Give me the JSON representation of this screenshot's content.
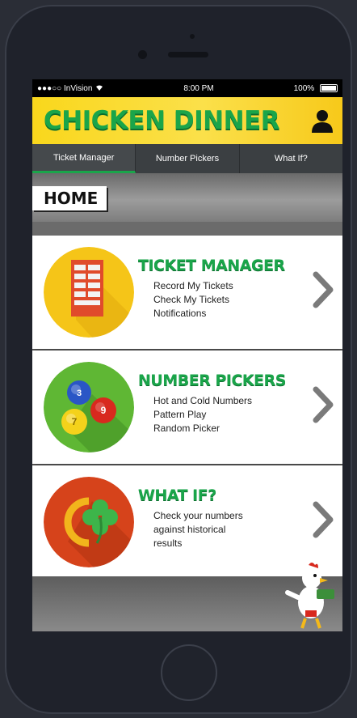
{
  "statusbar": {
    "carrier": "●●●○○ InVision",
    "time": "8:00 PM",
    "battery": "100%"
  },
  "header": {
    "title": "CHICKEN DINNER"
  },
  "tabs": [
    {
      "label": "Ticket Manager"
    },
    {
      "label": "Number Pickers"
    },
    {
      "label": "What If?"
    }
  ],
  "home": {
    "label": "HOME"
  },
  "cards": [
    {
      "title": "TICKET MANAGER",
      "lines": [
        "Record My Tickets",
        "Check My Tickets",
        "Notifications"
      ]
    },
    {
      "title": "NUMBER PICKERS",
      "lines": [
        "Hot and Cold Numbers",
        "Pattern Play",
        "Random Picker"
      ]
    },
    {
      "title": "WHAT IF?",
      "lines": [
        "Check your numbers",
        "against historical",
        "results"
      ]
    }
  ],
  "balls": [
    "3",
    "9",
    "7"
  ],
  "colors": {
    "accent": "#1aa54a",
    "header_bg": "#f9d71c",
    "tab_bg": "#3b3f42",
    "icon1": "#f5c518",
    "icon2": "#5fb734",
    "icon3": "#d6431b"
  }
}
